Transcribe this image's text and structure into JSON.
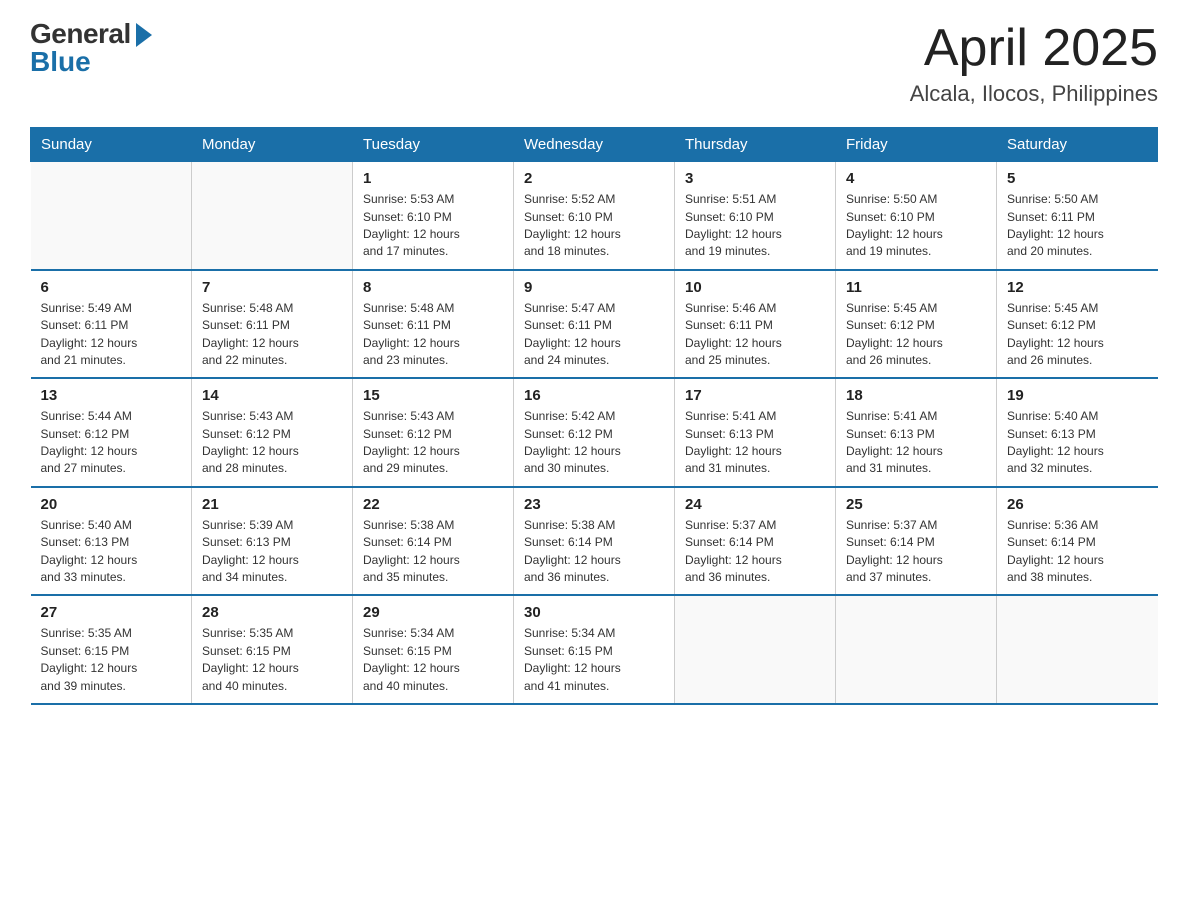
{
  "logo": {
    "general": "General",
    "blue": "Blue"
  },
  "header": {
    "month_year": "April 2025",
    "location": "Alcala, Ilocos, Philippines"
  },
  "weekdays": [
    "Sunday",
    "Monday",
    "Tuesday",
    "Wednesday",
    "Thursday",
    "Friday",
    "Saturday"
  ],
  "weeks": [
    [
      {
        "day": "",
        "info": ""
      },
      {
        "day": "",
        "info": ""
      },
      {
        "day": "1",
        "info": "Sunrise: 5:53 AM\nSunset: 6:10 PM\nDaylight: 12 hours\nand 17 minutes."
      },
      {
        "day": "2",
        "info": "Sunrise: 5:52 AM\nSunset: 6:10 PM\nDaylight: 12 hours\nand 18 minutes."
      },
      {
        "day": "3",
        "info": "Sunrise: 5:51 AM\nSunset: 6:10 PM\nDaylight: 12 hours\nand 19 minutes."
      },
      {
        "day": "4",
        "info": "Sunrise: 5:50 AM\nSunset: 6:10 PM\nDaylight: 12 hours\nand 19 minutes."
      },
      {
        "day": "5",
        "info": "Sunrise: 5:50 AM\nSunset: 6:11 PM\nDaylight: 12 hours\nand 20 minutes."
      }
    ],
    [
      {
        "day": "6",
        "info": "Sunrise: 5:49 AM\nSunset: 6:11 PM\nDaylight: 12 hours\nand 21 minutes."
      },
      {
        "day": "7",
        "info": "Sunrise: 5:48 AM\nSunset: 6:11 PM\nDaylight: 12 hours\nand 22 minutes."
      },
      {
        "day": "8",
        "info": "Sunrise: 5:48 AM\nSunset: 6:11 PM\nDaylight: 12 hours\nand 23 minutes."
      },
      {
        "day": "9",
        "info": "Sunrise: 5:47 AM\nSunset: 6:11 PM\nDaylight: 12 hours\nand 24 minutes."
      },
      {
        "day": "10",
        "info": "Sunrise: 5:46 AM\nSunset: 6:11 PM\nDaylight: 12 hours\nand 25 minutes."
      },
      {
        "day": "11",
        "info": "Sunrise: 5:45 AM\nSunset: 6:12 PM\nDaylight: 12 hours\nand 26 minutes."
      },
      {
        "day": "12",
        "info": "Sunrise: 5:45 AM\nSunset: 6:12 PM\nDaylight: 12 hours\nand 26 minutes."
      }
    ],
    [
      {
        "day": "13",
        "info": "Sunrise: 5:44 AM\nSunset: 6:12 PM\nDaylight: 12 hours\nand 27 minutes."
      },
      {
        "day": "14",
        "info": "Sunrise: 5:43 AM\nSunset: 6:12 PM\nDaylight: 12 hours\nand 28 minutes."
      },
      {
        "day": "15",
        "info": "Sunrise: 5:43 AM\nSunset: 6:12 PM\nDaylight: 12 hours\nand 29 minutes."
      },
      {
        "day": "16",
        "info": "Sunrise: 5:42 AM\nSunset: 6:12 PM\nDaylight: 12 hours\nand 30 minutes."
      },
      {
        "day": "17",
        "info": "Sunrise: 5:41 AM\nSunset: 6:13 PM\nDaylight: 12 hours\nand 31 minutes."
      },
      {
        "day": "18",
        "info": "Sunrise: 5:41 AM\nSunset: 6:13 PM\nDaylight: 12 hours\nand 31 minutes."
      },
      {
        "day": "19",
        "info": "Sunrise: 5:40 AM\nSunset: 6:13 PM\nDaylight: 12 hours\nand 32 minutes."
      }
    ],
    [
      {
        "day": "20",
        "info": "Sunrise: 5:40 AM\nSunset: 6:13 PM\nDaylight: 12 hours\nand 33 minutes."
      },
      {
        "day": "21",
        "info": "Sunrise: 5:39 AM\nSunset: 6:13 PM\nDaylight: 12 hours\nand 34 minutes."
      },
      {
        "day": "22",
        "info": "Sunrise: 5:38 AM\nSunset: 6:14 PM\nDaylight: 12 hours\nand 35 minutes."
      },
      {
        "day": "23",
        "info": "Sunrise: 5:38 AM\nSunset: 6:14 PM\nDaylight: 12 hours\nand 36 minutes."
      },
      {
        "day": "24",
        "info": "Sunrise: 5:37 AM\nSunset: 6:14 PM\nDaylight: 12 hours\nand 36 minutes."
      },
      {
        "day": "25",
        "info": "Sunrise: 5:37 AM\nSunset: 6:14 PM\nDaylight: 12 hours\nand 37 minutes."
      },
      {
        "day": "26",
        "info": "Sunrise: 5:36 AM\nSunset: 6:14 PM\nDaylight: 12 hours\nand 38 minutes."
      }
    ],
    [
      {
        "day": "27",
        "info": "Sunrise: 5:35 AM\nSunset: 6:15 PM\nDaylight: 12 hours\nand 39 minutes."
      },
      {
        "day": "28",
        "info": "Sunrise: 5:35 AM\nSunset: 6:15 PM\nDaylight: 12 hours\nand 40 minutes."
      },
      {
        "day": "29",
        "info": "Sunrise: 5:34 AM\nSunset: 6:15 PM\nDaylight: 12 hours\nand 40 minutes."
      },
      {
        "day": "30",
        "info": "Sunrise: 5:34 AM\nSunset: 6:15 PM\nDaylight: 12 hours\nand 41 minutes."
      },
      {
        "day": "",
        "info": ""
      },
      {
        "day": "",
        "info": ""
      },
      {
        "day": "",
        "info": ""
      }
    ]
  ]
}
